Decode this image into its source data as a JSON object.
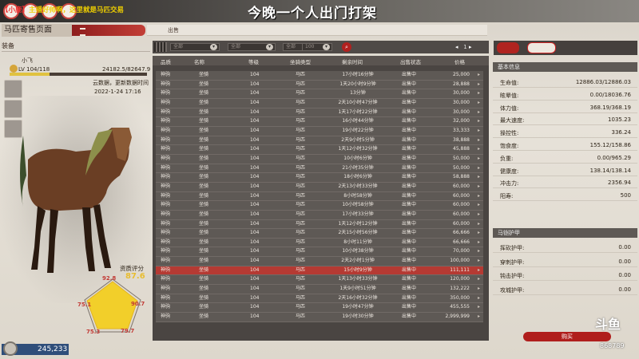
{
  "stream": {
    "marquee_prefix": "【小鹿】",
    "marquee_text": "主播好帅啊，这里就是马匹交易",
    "title_banner": "今晚一个人出门打架"
  },
  "header": {
    "page_title": "马匹寄售页面",
    "sell_tab": "出售"
  },
  "left": {
    "equip_label": "装备",
    "horse_name": "小飞",
    "level": "LV 104/118",
    "exp": "24182.5/82647.9",
    "exp_fraction": 0.29,
    "cloud_note": "云数据，更新数据时间",
    "cloud_date": "2022-1-24 17:16",
    "aptitude_title": "资质评分",
    "aptitude_score": "87.6",
    "aptitude_values": [
      "92.8",
      "90.7",
      "79.7",
      "75.3",
      "75.1"
    ],
    "currency": "245,233"
  },
  "filters": {
    "dropdowns": [
      "全部",
      "全部",
      "全部",
      "100"
    ],
    "page": "1"
  },
  "table": {
    "columns": [
      "品质",
      "名称",
      "等级",
      "坐骑类型",
      "剩余时间",
      "出售状态",
      "价格"
    ],
    "rows": [
      [
        "神驹",
        "坐骑",
        "104",
        "马匹",
        "17小时16分钟",
        "出售中",
        "25,000"
      ],
      [
        "神驹",
        "坐骑",
        "104",
        "马匹",
        "1天20小时9分钟",
        "出售中",
        "28,888"
      ],
      [
        "神驹",
        "坐骑",
        "104",
        "马匹",
        "13分钟",
        "出售中",
        "30,000"
      ],
      [
        "神驹",
        "坐骑",
        "104",
        "马匹",
        "2天10小时47分钟",
        "出售中",
        "30,000"
      ],
      [
        "神驹",
        "坐骑",
        "104",
        "马匹",
        "1天17小时22分钟",
        "出售中",
        "30,000"
      ],
      [
        "神驹",
        "坐骑",
        "104",
        "马匹",
        "16小时44分钟",
        "出售中",
        "32,000"
      ],
      [
        "神驹",
        "坐骑",
        "104",
        "马匹",
        "19小时22分钟",
        "出售中",
        "33,333"
      ],
      [
        "神驹",
        "坐骑",
        "104",
        "马匹",
        "2天9小时5分钟",
        "出售中",
        "38,888"
      ],
      [
        "神驹",
        "坐骑",
        "104",
        "马匹",
        "1天12小时32分钟",
        "出售中",
        "45,888"
      ],
      [
        "神驹",
        "坐骑",
        "104",
        "马匹",
        "10小时6分钟",
        "出售中",
        "50,000"
      ],
      [
        "神驹",
        "坐骑",
        "104",
        "马匹",
        "21小时35分钟",
        "出售中",
        "50,000"
      ],
      [
        "神驹",
        "坐骑",
        "104",
        "马匹",
        "18小时6分钟",
        "出售中",
        "58,888"
      ],
      [
        "神驹",
        "坐骑",
        "104",
        "马匹",
        "2天13小时33分钟",
        "出售中",
        "60,000"
      ],
      [
        "神驹",
        "坐骑",
        "104",
        "马匹",
        "8小时58分钟",
        "出售中",
        "60,000"
      ],
      [
        "神驹",
        "坐骑",
        "104",
        "马匹",
        "10小时58分钟",
        "出售中",
        "60,000"
      ],
      [
        "神驹",
        "坐骑",
        "104",
        "马匹",
        "17小时33分钟",
        "出售中",
        "60,000"
      ],
      [
        "神驹",
        "坐骑",
        "104",
        "马匹",
        "1天12小时12分钟",
        "出售中",
        "60,000"
      ],
      [
        "神驹",
        "坐骑",
        "104",
        "马匹",
        "2天15小时56分钟",
        "出售中",
        "66,666"
      ],
      [
        "神驹",
        "坐骑",
        "104",
        "马匹",
        "8小时11分钟",
        "出售中",
        "66,666"
      ],
      [
        "神驹",
        "坐骑",
        "104",
        "马匹",
        "10小时38分钟",
        "出售中",
        "70,000"
      ],
      [
        "神驹",
        "坐骑",
        "104",
        "马匹",
        "2天2小时1分钟",
        "出售中",
        "100,000"
      ],
      [
        "神驹",
        "坐骑",
        "104",
        "马匹",
        "15小时9分钟",
        "出售中",
        "111,111"
      ],
      [
        "神驹",
        "坐骑",
        "104",
        "马匹",
        "1天13小时33分钟",
        "出售中",
        "120,000"
      ],
      [
        "神驹",
        "坐骑",
        "104",
        "马匹",
        "1天9小时51分钟",
        "出售中",
        "132,222"
      ],
      [
        "神驹",
        "坐骑",
        "104",
        "马匹",
        "2天16小时32分钟",
        "出售中",
        "350,000"
      ],
      [
        "神驹",
        "坐骑",
        "104",
        "马匹",
        "19小时47分钟",
        "出售中",
        "455,555"
      ],
      [
        "神驹",
        "坐骑",
        "104",
        "马匹",
        "19小时30分钟",
        "出售中",
        "2,999,999"
      ]
    ]
  },
  "right": {
    "basic_title": "基本信息",
    "stats": [
      {
        "label": "生命值:",
        "value": "12886.03/12886.03"
      },
      {
        "label": "眩晕值:",
        "value": "0.00/18036.76"
      },
      {
        "label": "体力值:",
        "value": "368.19/368.19"
      },
      {
        "label": "最大速度:",
        "value": "1035.23"
      },
      {
        "label": "操控性:",
        "value": "336.24"
      },
      {
        "label": "饱食度:",
        "value": "155.12/158.86"
      },
      {
        "label": "负重:",
        "value": "0.00/965.29"
      },
      {
        "label": "健康度:",
        "value": "138.14/138.14"
      },
      {
        "label": "冲击力:",
        "value": "2356.94"
      },
      {
        "label": "阳寿:",
        "value": "500"
      }
    ],
    "armor_title": "马铠护甲",
    "armor": [
      {
        "label": "挥砍护甲:",
        "value": "0.00"
      },
      {
        "label": "穿刺护甲:",
        "value": "0.00"
      },
      {
        "label": "钝击护甲:",
        "value": "0.00"
      },
      {
        "label": "攻城护甲:",
        "value": "0.00"
      }
    ],
    "buy_label": "购买",
    "watermark": "斗鱼",
    "room_id": "868789"
  }
}
